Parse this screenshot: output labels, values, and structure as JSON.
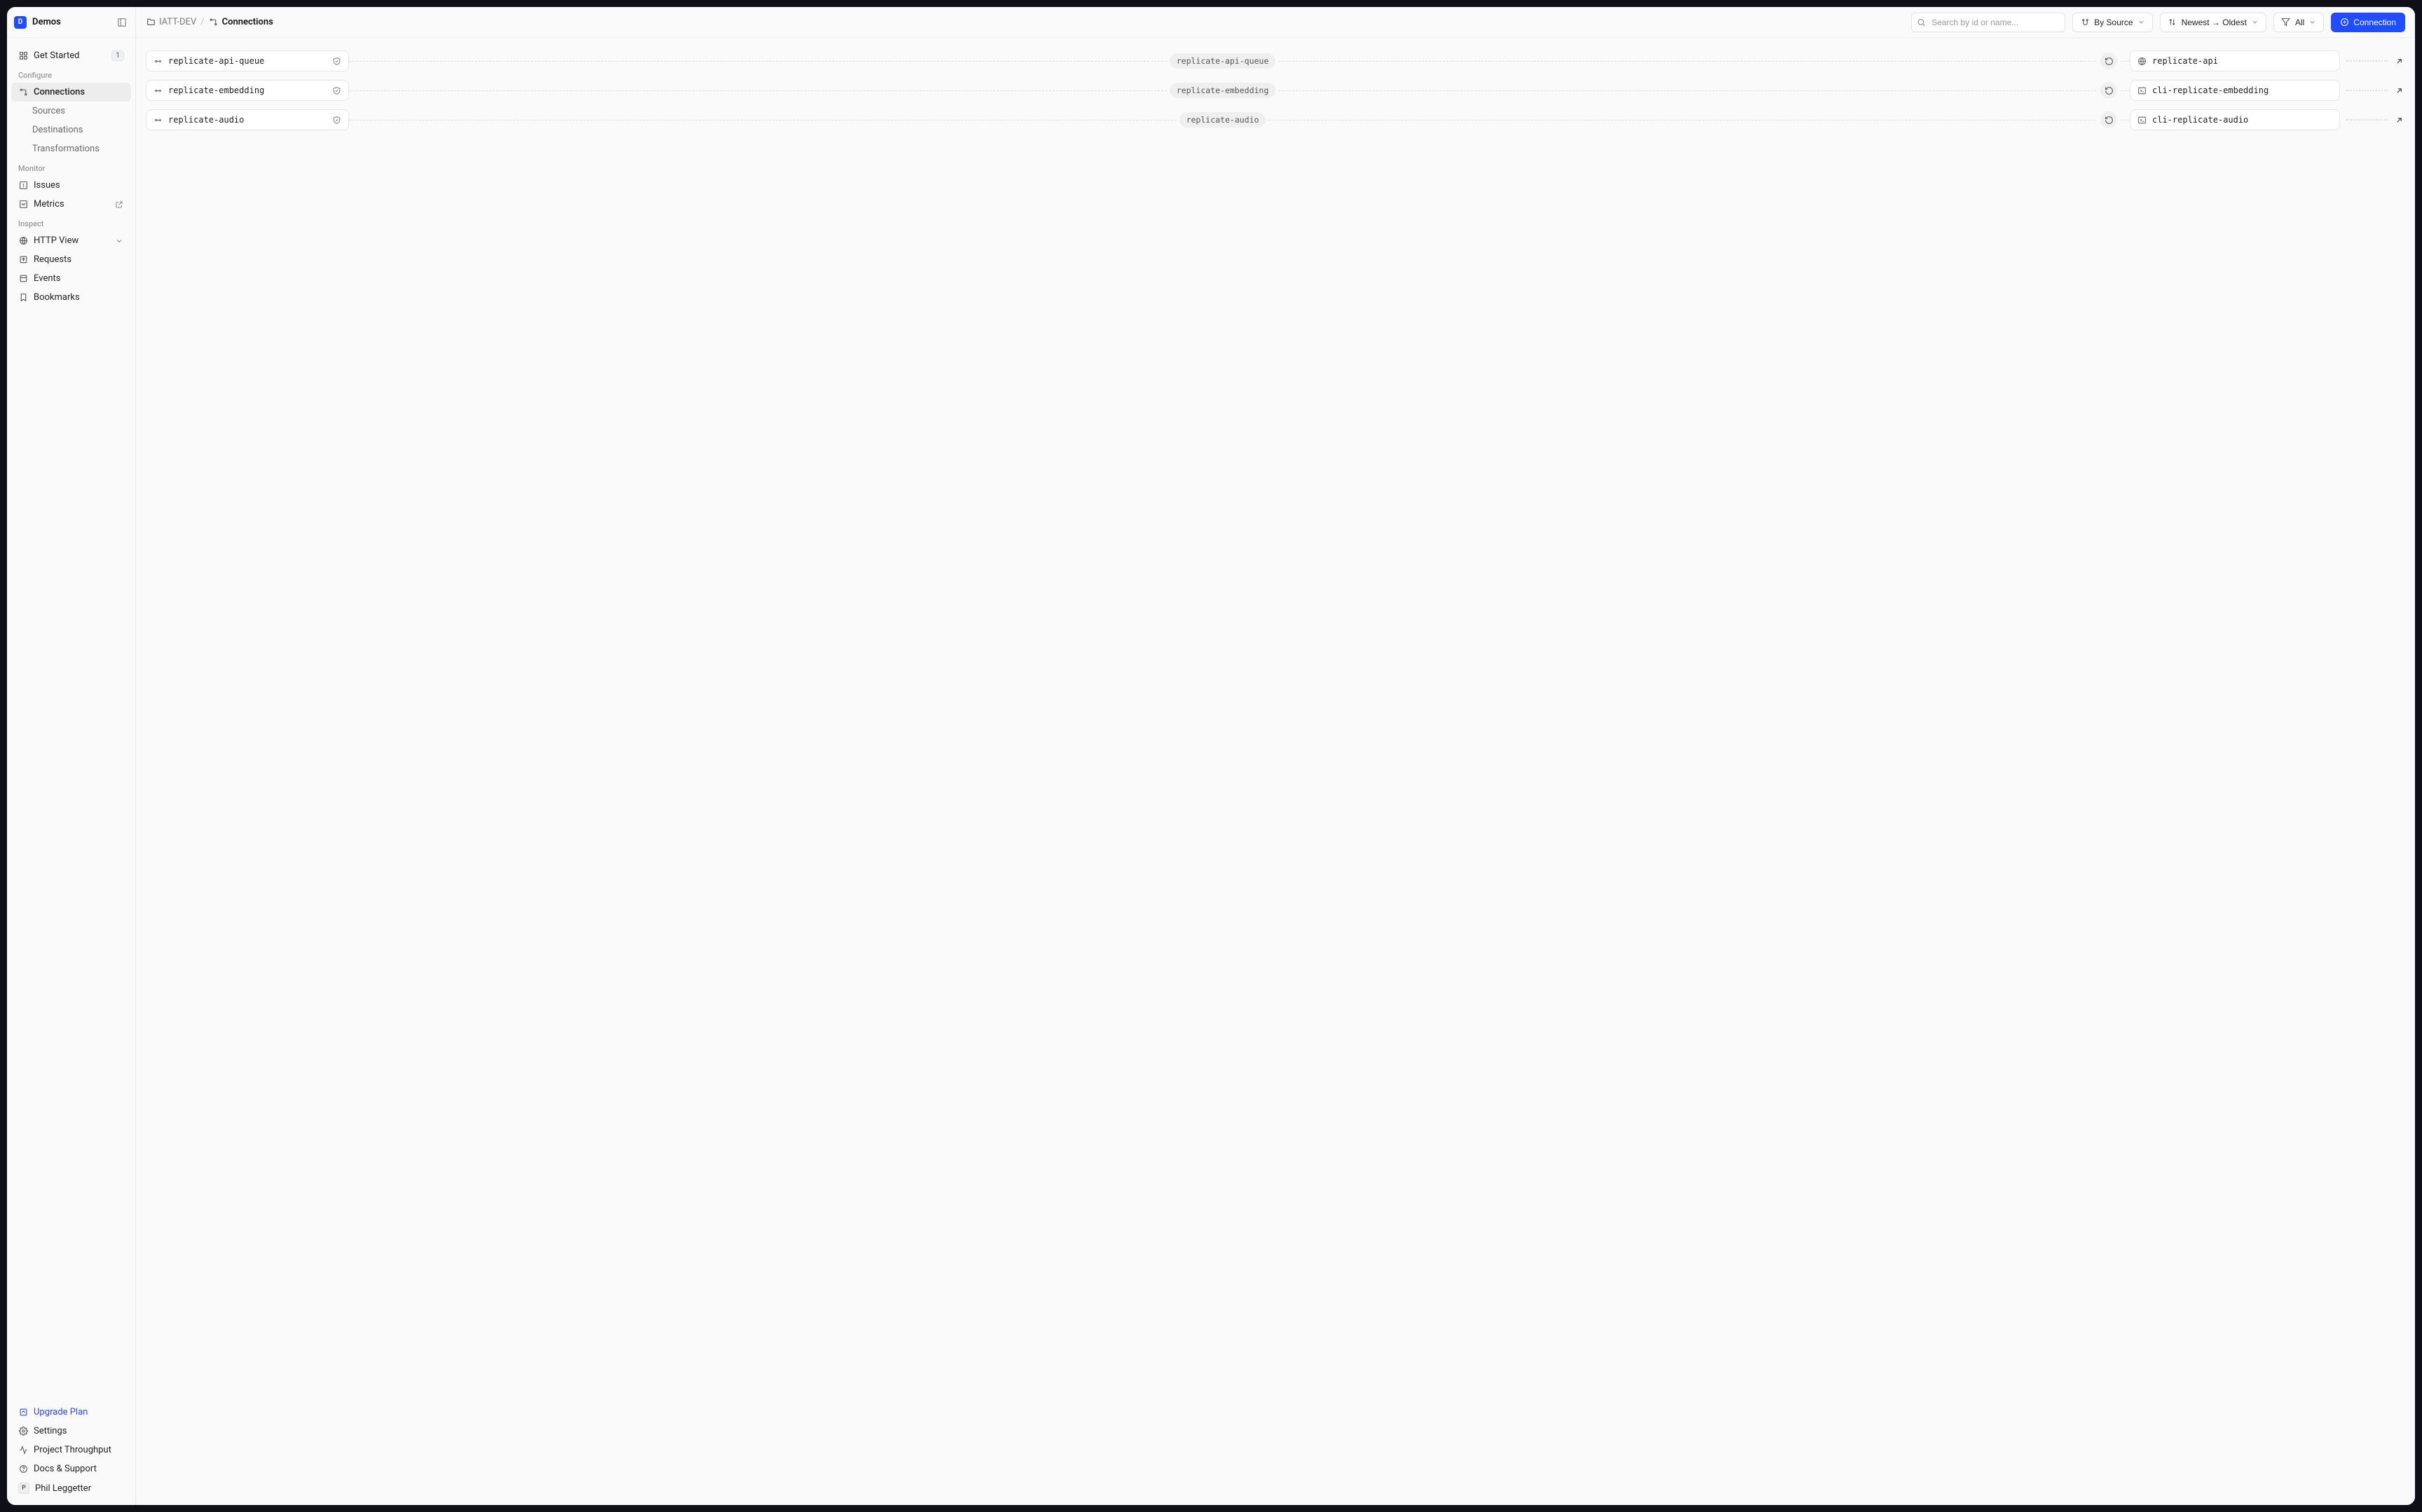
{
  "workspace": {
    "badge": "D",
    "name": "Demos"
  },
  "sidebar": {
    "get_started": {
      "label": "Get Started",
      "badge": "1"
    },
    "sections": {
      "configure": "Configure",
      "monitor": "Monitor",
      "inspect": "Inspect"
    },
    "connections": "Connections",
    "sources": "Sources",
    "destinations": "Destinations",
    "transformations": "Transformations",
    "issues": "Issues",
    "metrics": "Metrics",
    "http_view": "HTTP View",
    "requests": "Requests",
    "events": "Events",
    "bookmarks": "Bookmarks",
    "upgrade": "Upgrade Plan",
    "settings": "Settings",
    "throughput": "Project Throughput",
    "support": "Docs & Support",
    "user": {
      "initial": "P",
      "name": "Phil Leggetter"
    }
  },
  "header": {
    "breadcrumb": {
      "folder": "IATT-DEV",
      "current": "Connections"
    },
    "search_placeholder": "Search by id or name...",
    "group_by": "By Source",
    "sort": "Newest → Oldest",
    "filter": "All",
    "primary": "Connection"
  },
  "connections": [
    {
      "source": "replicate-api-queue",
      "name": "replicate-api-queue",
      "dest": "replicate-api",
      "dest_icon": "globe"
    },
    {
      "source": "replicate-embedding",
      "name": "replicate-embedding",
      "dest": "cli-replicate-embedding",
      "dest_icon": "terminal"
    },
    {
      "source": "replicate-audio",
      "name": "replicate-audio",
      "dest": "cli-replicate-audio",
      "dest_icon": "terminal"
    }
  ]
}
